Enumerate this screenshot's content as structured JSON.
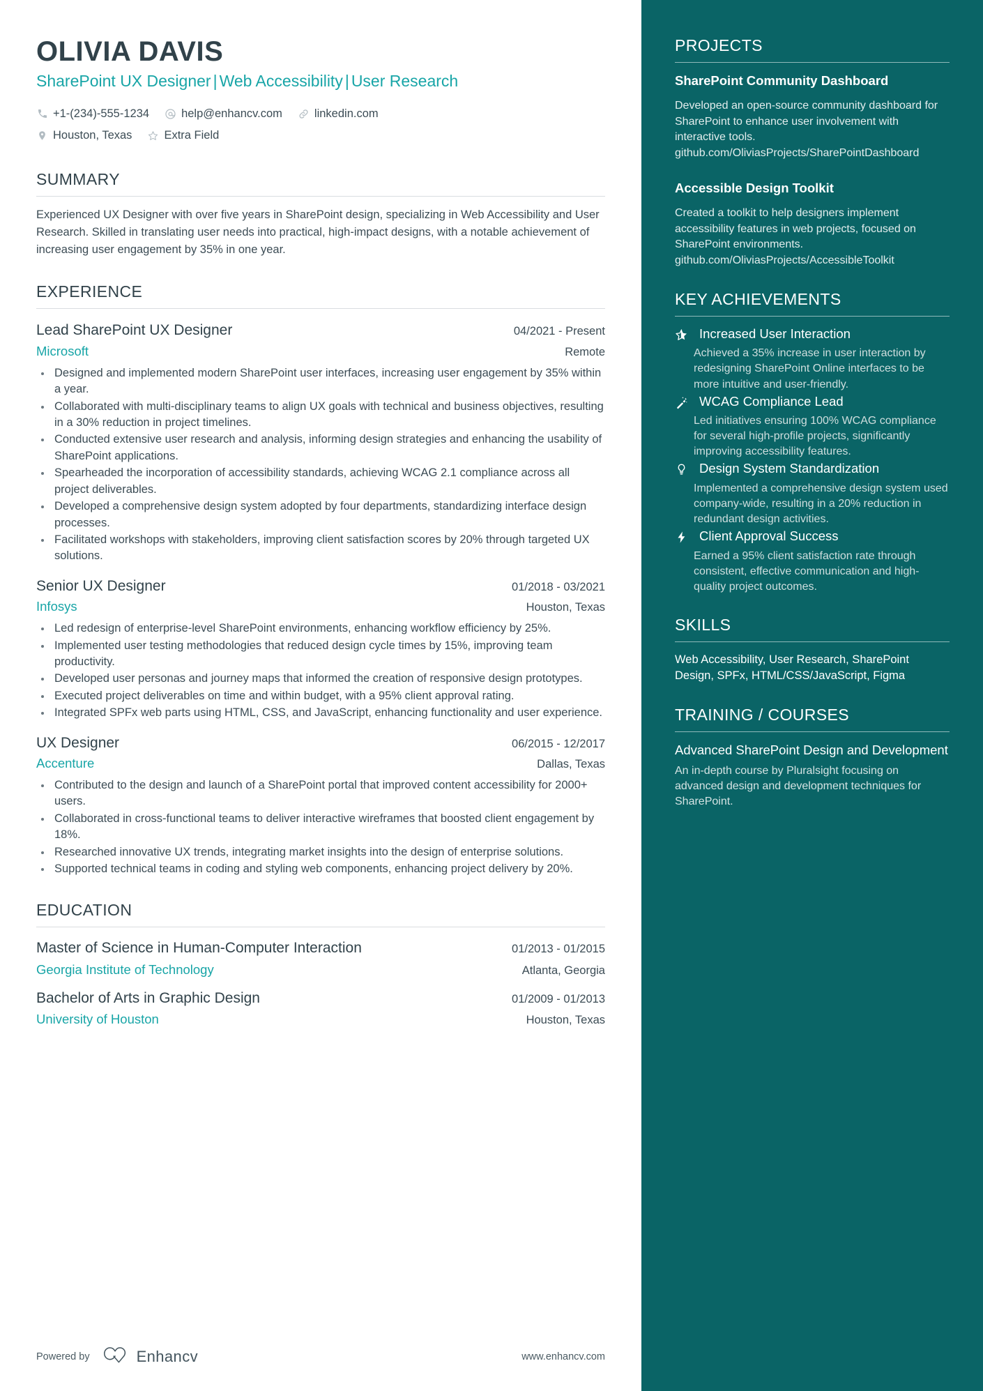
{
  "colors": {
    "accent_teal": "#18a5a7",
    "sidebar_bg": "#0a6466",
    "heading": "#31424a",
    "body": "#3c4c55"
  },
  "header": {
    "name": "OLIVIA DAVIS",
    "headline_parts": [
      "SharePoint UX Designer",
      "Web Accessibility",
      "User Research"
    ],
    "separator": "|",
    "contacts_row1": [
      {
        "icon": "phone-icon",
        "value": "+1-(234)-555-1234"
      },
      {
        "icon": "email-icon",
        "value": "help@enhancv.com"
      },
      {
        "icon": "link-icon",
        "value": "linkedin.com"
      }
    ],
    "contacts_row2": [
      {
        "icon": "location-pin-icon",
        "value": "Houston, Texas"
      },
      {
        "icon": "star-outline-icon",
        "value": "Extra Field"
      }
    ]
  },
  "summary": {
    "title": "SUMMARY",
    "text": "Experienced UX Designer with over five years in SharePoint design, specializing in Web Accessibility and User Research. Skilled in translating user needs into practical, high-impact designs, with a notable achievement of increasing user engagement by 35% in one year."
  },
  "experience": {
    "title": "EXPERIENCE",
    "jobs": [
      {
        "title": "Lead SharePoint UX Designer",
        "date": "04/2021 - Present",
        "company": "Microsoft",
        "location": "Remote",
        "bullets": [
          "Designed and implemented modern SharePoint user interfaces, increasing user engagement by 35% within a year.",
          "Collaborated with multi-disciplinary teams to align UX goals with technical and business objectives, resulting in a 30% reduction in project timelines.",
          "Conducted extensive user research and analysis, informing design strategies and enhancing the usability of SharePoint applications.",
          "Spearheaded the incorporation of accessibility standards, achieving WCAG 2.1 compliance across all project deliverables.",
          "Developed a comprehensive design system adopted by four departments, standardizing interface design processes.",
          "Facilitated workshops with stakeholders, improving client satisfaction scores by 20% through targeted UX solutions."
        ]
      },
      {
        "title": "Senior UX Designer",
        "date": "01/2018 - 03/2021",
        "company": "Infosys",
        "location": "Houston, Texas",
        "bullets": [
          "Led redesign of enterprise-level SharePoint environments, enhancing workflow efficiency by 25%.",
          "Implemented user testing methodologies that reduced design cycle times by 15%, improving team productivity.",
          "Developed user personas and journey maps that informed the creation of responsive design prototypes.",
          "Executed project deliverables on time and within budget, with a 95% client approval rating.",
          "Integrated SPFx web parts using HTML, CSS, and JavaScript, enhancing functionality and user experience."
        ]
      },
      {
        "title": "UX Designer",
        "date": "06/2015 - 12/2017",
        "company": "Accenture",
        "location": "Dallas, Texas",
        "bullets": [
          "Contributed to the design and launch of a SharePoint portal that improved content accessibility for 2000+ users.",
          "Collaborated in cross-functional teams to deliver interactive wireframes that boosted client engagement by 18%.",
          "Researched innovative UX trends, integrating market insights into the design of enterprise solutions.",
          "Supported technical teams in coding and styling web components, enhancing project delivery by 20%."
        ]
      }
    ]
  },
  "education": {
    "title": "EDUCATION",
    "entries": [
      {
        "degree": "Master of Science in Human-Computer Interaction",
        "date": "01/2013 - 01/2015",
        "school": "Georgia Institute of Technology",
        "location": "Atlanta, Georgia"
      },
      {
        "degree": "Bachelor of Arts in Graphic Design",
        "date": "01/2009 - 01/2013",
        "school": "University of Houston",
        "location": "Houston, Texas"
      }
    ]
  },
  "footer": {
    "powered_by": "Powered by",
    "brand": "Enhancv",
    "website": "www.enhancv.com"
  },
  "sidebar": {
    "projects": {
      "title": "PROJECTS",
      "items": [
        {
          "name": "SharePoint Community Dashboard",
          "description": "Developed an open-source community dashboard for SharePoint to enhance user involvement with interactive tools. github.com/OliviasProjects/SharePointDashboard"
        },
        {
          "name": "Accessible Design Toolkit",
          "description": "Created a toolkit to help designers implement accessibility features in web projects, focused on SharePoint environments. github.com/OliviasProjects/AccessibleToolkit"
        }
      ]
    },
    "achievements": {
      "title": "KEY ACHIEVEMENTS",
      "items": [
        {
          "icon": "half-star-icon",
          "title": "Increased User Interaction",
          "description": "Achieved a 35% increase in user interaction by redesigning SharePoint Online interfaces to be more intuitive and user-friendly."
        },
        {
          "icon": "magic-wand-icon",
          "title": "WCAG Compliance Lead",
          "description": "Led initiatives ensuring 100% WCAG compliance for several high-profile projects, significantly improving accessibility features."
        },
        {
          "icon": "lightbulb-icon",
          "title": "Design System Standardization",
          "description": "Implemented a comprehensive design system used company-wide, resulting in a 20% reduction in redundant design activities."
        },
        {
          "icon": "lightning-bolt-icon",
          "title": "Client Approval Success",
          "description": "Earned a 95% client satisfaction rate through consistent, effective communication and high-quality project outcomes."
        }
      ]
    },
    "skills": {
      "title": "SKILLS",
      "text": "Web Accessibility, User Research, SharePoint Design, SPFx, HTML/CSS/JavaScript, Figma"
    },
    "training": {
      "title": "TRAINING / COURSES",
      "items": [
        {
          "name": "Advanced SharePoint Design and Development",
          "description": "An in-depth course by Pluralsight focusing on advanced design and development techniques for SharePoint."
        }
      ]
    }
  }
}
